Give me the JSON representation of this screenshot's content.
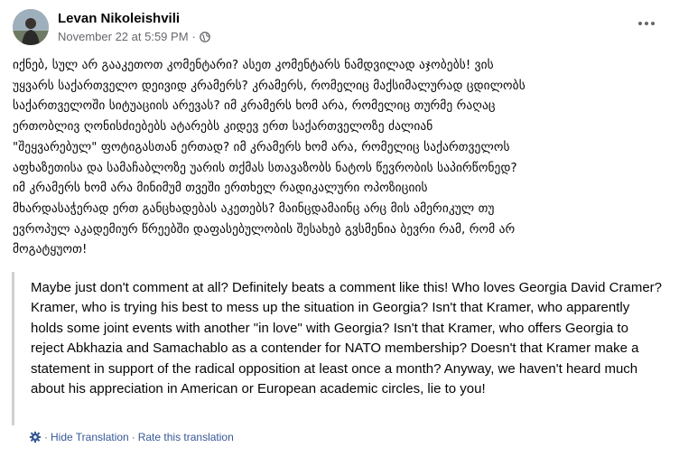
{
  "post": {
    "author": "Levan Nikoleishvili",
    "date": "November 22 at 5:59 PM",
    "separator": "·",
    "audience_icon": "globe-icon",
    "more_icon": "more-horizontal-icon",
    "text": "იქნებ, სულ არ გააკეთოთ კომენტარი? ასეთ კომენტარს ნამდვილად აჯობებს! ვის\nუყვარს საქართველო დეივიდ კრამერს? კრამერს, რომელიც მაქსიმალურად ცდილობს\nსაქართველოში სიტუაციის არევას? იმ კრამერს ხომ არა, რომელიც თურმე რაღაც\nერთობლივ ღონისძიებებს ატარებს კიდევ ერთ საქართველოზე ძალიან\n\"შეყვარებულ\" ფოტიგასთან ერთად? იმ კრამერს ხომ არა, რომელიც საქართველოს\nაფხაზეთისა და სამაჩაბლოზე უარის თქმას სთავაზობს ნატოს წევრობის საპირწონედ?\nიმ კრამერს ხომ არა მინიმუმ თვეში ერთხელ რადიკალური ოპოზიციის\nმხარდასაჭერად ერთ განცხადებას აკეთებს? მაინცდამაინც არც მის ამერიკულ თუ\nევროპულ აკადემიურ წრეებში დაფასებულობის შესახებ გვსმენია ბევრი რამ, რომ არ\nმოგატყუოთ!"
  },
  "translation": {
    "text": "Maybe just don't comment at all? Definitely beats a comment like this! Who loves Georgia David Cramer? Kramer, who is trying his best to mess up the situation in Georgia? Isn't that Kramer, who apparently holds some joint events with another \"in love\" with Georgia? Isn't that Kramer, who offers Georgia to reject Abkhazia and Samachablo as a contender for NATO membership? Doesn't that Kramer make a statement in support of the radical opposition at least once a month? Anyway, we haven't heard much about his appreciation in American or European academic circles, lie to you!",
    "settings_icon": "gear-icon",
    "hide_label": "Hide Translation",
    "separator": "·",
    "rate_label": "Rate this translation"
  },
  "colors": {
    "link": "#385898",
    "muted": "#65676b",
    "quote_border": "#ced0d4"
  }
}
